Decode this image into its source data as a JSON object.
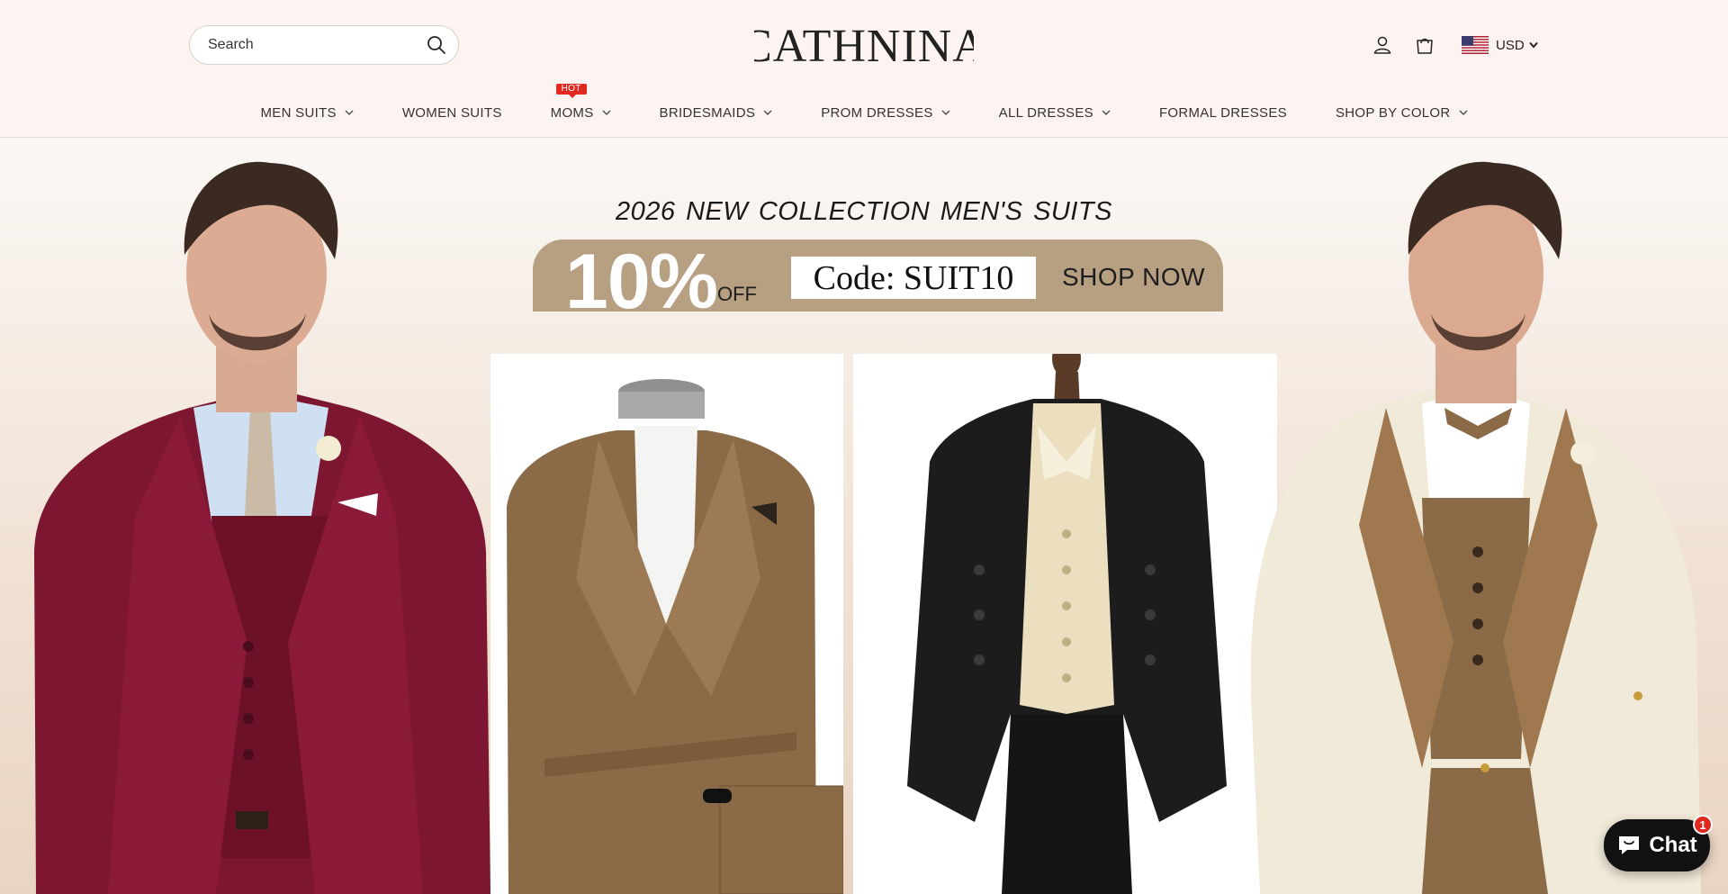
{
  "header": {
    "search_placeholder": "Search",
    "logo_text": "CATHNINA",
    "currency": "USD",
    "icons": [
      "search-icon",
      "account-icon",
      "cart-icon",
      "us-flag-icon",
      "caret-down-icon"
    ]
  },
  "nav": {
    "items": [
      {
        "label": "MEN SUITS",
        "has_dropdown": true
      },
      {
        "label": "WOMEN SUITS",
        "has_dropdown": false
      },
      {
        "label": "MOMS",
        "has_dropdown": true,
        "badge": "HOT"
      },
      {
        "label": "BRIDESMAIDS",
        "has_dropdown": true
      },
      {
        "label": "PROM DRESSES",
        "has_dropdown": true
      },
      {
        "label": "ALL DRESSES",
        "has_dropdown": true
      },
      {
        "label": "FORMAL DRESSES",
        "has_dropdown": false
      },
      {
        "label": "SHOP BY COLOR",
        "has_dropdown": true
      }
    ]
  },
  "hero": {
    "headline": "2026 NEW COLLECTION  MEN'S SUITS",
    "discount": "10%",
    "off": "OFF",
    "code": "Code: SUIT10",
    "cta": "SHOP NOW"
  },
  "chat": {
    "label": "Chat",
    "badge": "1"
  },
  "colors": {
    "header_bg": "#fdf4f1",
    "promo_band": "#b79f82",
    "hot_badge": "#e0281f",
    "burgundy_suit": "#7d1630",
    "brown_suit": "#8b6a47",
    "black_suit": "#1c1c1c",
    "cream_jacket": "#f1ead9"
  }
}
